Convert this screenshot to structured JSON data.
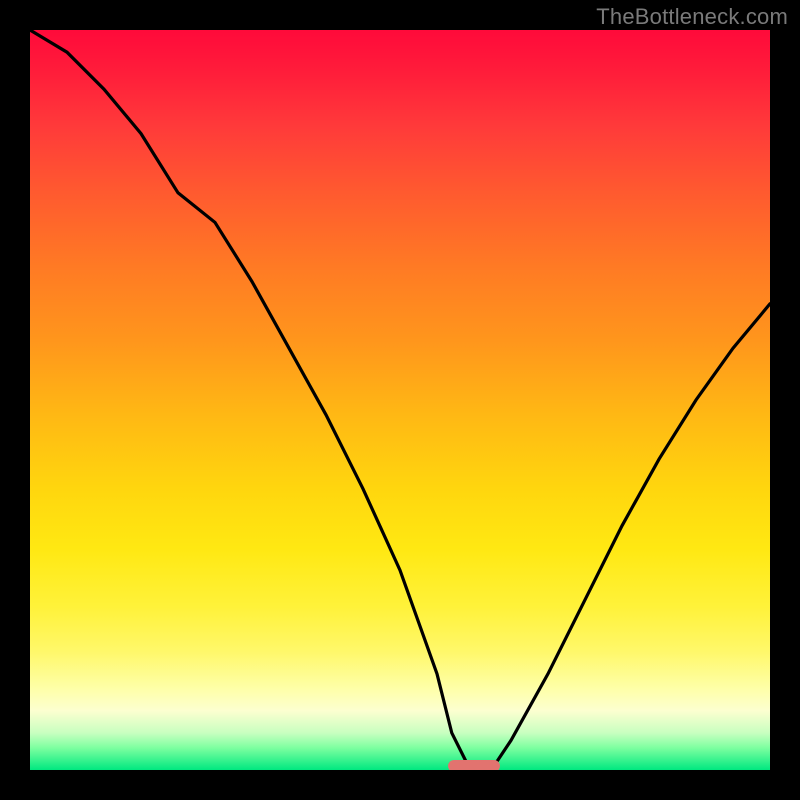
{
  "watermark": "TheBottleneck.com",
  "chart_data": {
    "type": "line",
    "title": "",
    "xlabel": "",
    "ylabel": "",
    "xlim": [
      0,
      100
    ],
    "ylim": [
      0,
      100
    ],
    "grid": false,
    "series": [
      {
        "name": "bottleneck-curve",
        "x": [
          0,
          5,
          10,
          15,
          20,
          25,
          30,
          35,
          40,
          45,
          50,
          55,
          57,
          59,
          61,
          63,
          65,
          70,
          75,
          80,
          85,
          90,
          95,
          100
        ],
        "y": [
          100,
          97,
          92,
          86,
          78,
          74,
          66,
          57,
          48,
          38,
          27,
          13,
          5,
          1,
          0,
          1,
          4,
          13,
          23,
          33,
          42,
          50,
          57,
          63
        ]
      }
    ],
    "marker": {
      "name": "optimal-range",
      "x_center": 60,
      "y": 0,
      "width": 7,
      "color": "#e2736f"
    },
    "background_gradient": {
      "stops": [
        {
          "pos": 0,
          "color": "#ff0a3a"
        },
        {
          "pos": 50,
          "color": "#ffb814"
        },
        {
          "pos": 80,
          "color": "#fff23a"
        },
        {
          "pos": 100,
          "color": "#00e880"
        }
      ]
    }
  }
}
